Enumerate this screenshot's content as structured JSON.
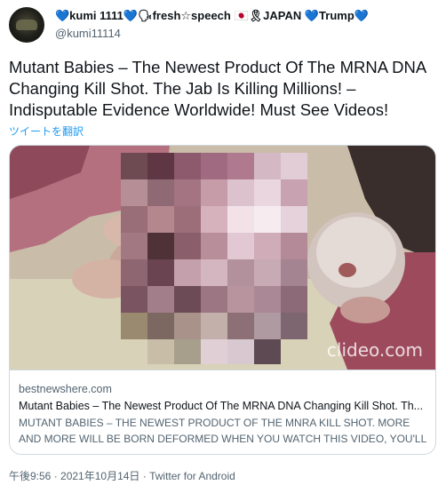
{
  "author": {
    "display_name": "💙kumi 1111💙🗣fresh☆speech 🇯🇵🎗JAPAN 💙Trump💙",
    "handle": "@kumi11114"
  },
  "tweet": {
    "text": "Mutant Babies – The Newest Product Of The MRNA DNA Changing Kill Shot. The Jab Is Killing Millions! – Indisputable Evidence Worldwide! Must See Videos!",
    "translate_label": "ツイートを翻訳"
  },
  "card": {
    "watermark": "clideo.com",
    "domain": "bestnewshere.com",
    "title": "Mutant Babies – The Newest Product Of The MRNA DNA Changing Kill Shot. Th...",
    "description": "MUTANT BABIES – THE NEWEST PRODUCT OF THE MNRA KILL SHOT. MORE AND MORE WILL BE BORN DEFORMED WHEN YOU WATCH THIS VIDEO, YOU'LL ..."
  },
  "footer": {
    "timestamp": "午後9:56 · 2021年10月14日",
    "separator": " · ",
    "source": "Twitter for Android"
  }
}
